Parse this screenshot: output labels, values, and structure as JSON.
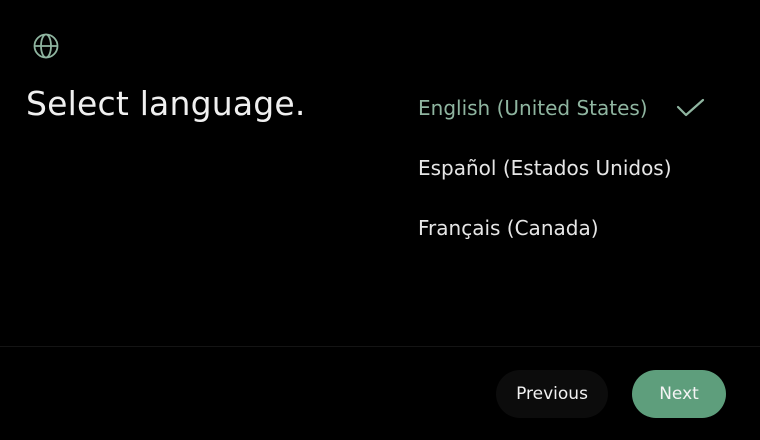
{
  "header": {
    "icon": "globe-icon",
    "title": "Select language."
  },
  "languages": [
    {
      "label": "English (United States)",
      "selected": true
    },
    {
      "label": "Español (Estados Unidos)",
      "selected": false
    },
    {
      "label": "Français (Canada)",
      "selected": false
    }
  ],
  "selected_indicator_icon": "checkmark-icon",
  "footer": {
    "previous_label": "Previous",
    "next_label": "Next"
  },
  "colors": {
    "background": "#000000",
    "accent": "#5e9e7c",
    "selected_text": "#8fb5a0",
    "icon": "#8fb5a0"
  }
}
